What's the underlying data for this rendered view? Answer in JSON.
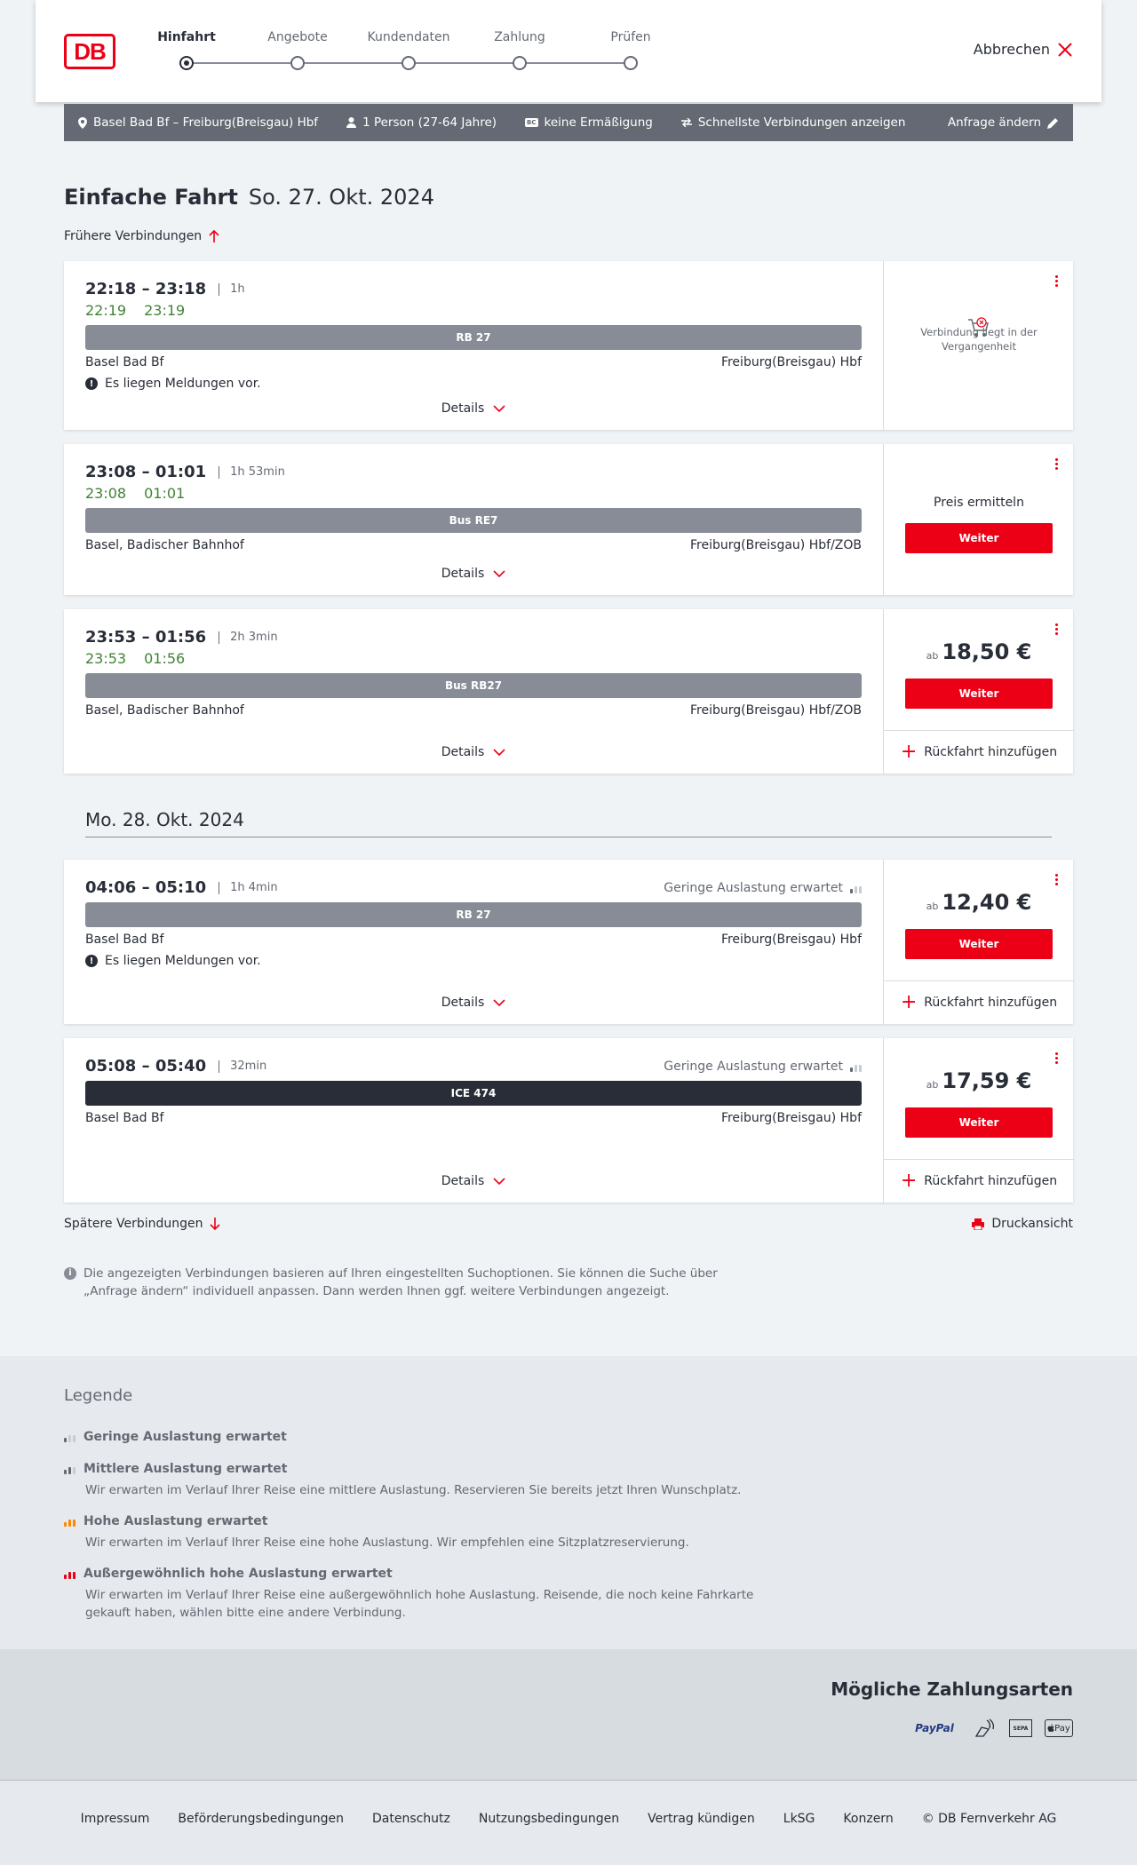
{
  "steps": [
    "Hinfahrt",
    "Angebote",
    "Kundendaten",
    "Zahlung",
    "Prüfen"
  ],
  "cancel": "Abbrechen",
  "search": {
    "route": "Basel Bad Bf – Freiburg(Breisgau) Hbf",
    "persons": "1 Person (27-64 Jahre)",
    "bc_badge": "BC",
    "discount": "keine Ermäßigung",
    "fastest": "Schnellste Verbindungen anzeigen",
    "change": "Anfrage ändern"
  },
  "heading": {
    "main": "Einfache Fahrt",
    "date": "So. 27. Okt. 2024"
  },
  "earlier": "Frühere Verbindungen",
  "later": "Spätere Verbindungen",
  "print": "Druckansicht",
  "details_label": "Details",
  "return_label": "Rückfahrt hinzufügen",
  "weiter_label": "Weiter",
  "price_prefix": "ab",
  "message": "Es liegen Meldungen vor.",
  "load_label": "Geringe Auslastung erwartet",
  "connections": [
    {
      "time": "22:18 – 23:18",
      "duration": "1h",
      "rt_dep": "22:19",
      "rt_arr": "23:19",
      "train": "RB 27",
      "from": "Basel Bad Bf",
      "to": "Freiburg(Breisgau) Hbf",
      "past": "Verbindung liegt in der Vergangenheit"
    },
    {
      "time": "23:08 – 01:01",
      "duration": "1h 53min",
      "rt_dep": "23:08",
      "rt_arr": "01:01",
      "train": "Bus RE7",
      "from": "Basel, Badischer Bahnhof",
      "to": "Freiburg(Breisgau) Hbf/ZOB",
      "price_text": "Preis ermitteln"
    },
    {
      "time": "23:53 – 01:56",
      "duration": "2h 3min",
      "rt_dep": "23:53",
      "rt_arr": "01:56",
      "train": "Bus RB27",
      "from": "Basel, Badischer Bahnhof",
      "to": "Freiburg(Breisgau) Hbf/ZOB",
      "price": "18,50 €"
    },
    {
      "time": "04:06 – 05:10",
      "duration": "1h 4min",
      "train": "RB 27",
      "from": "Basel Bad Bf",
      "to": "Freiburg(Breisgau) Hbf",
      "price": "12,40 €"
    },
    {
      "time": "05:08 – 05:40",
      "duration": "32min",
      "train": "ICE 474",
      "from": "Basel Bad Bf",
      "to": "Freiburg(Breisgau) Hbf",
      "price": "17,59 €"
    }
  ],
  "date2": "Mo. 28. Okt. 2024",
  "info": "Die angezeigten Verbindungen basieren auf Ihren eingestellten Suchoptionen. Sie können die Suche über „Anfrage ändern“ individuell anpassen. Dann werden Ihnen ggf. weitere Verbindungen angezeigt.",
  "legend": {
    "title": "Legende",
    "items": [
      {
        "title": "Geringe Auslastung erwartet",
        "desc": ""
      },
      {
        "title": "Mittlere Auslastung erwartet",
        "desc": "Wir erwarten im Verlauf Ihrer Reise eine mittlere Auslastung. Reservieren Sie bereits jetzt Ihren Wunschplatz."
      },
      {
        "title": "Hohe Auslastung erwartet",
        "desc": "Wir erwarten im Verlauf Ihrer Reise eine hohe Auslastung. Wir empfehlen eine Sitzplatzreservierung."
      },
      {
        "title": "Außergewöhnlich hohe Auslastung erwartet",
        "desc": "Wir erwarten im Verlauf Ihrer Reise eine außergewöhnlich hohe Auslastung. Reisende, die noch keine Fahrkarte gekauft haben, wählen bitte eine andere Verbindung."
      }
    ]
  },
  "payment": {
    "title": "Mögliche Zahlungsarten",
    "methods": [
      "PayPal",
      "SEPA",
      "Pay"
    ]
  },
  "footer": [
    "Impressum",
    "Beförderungsbedingungen",
    "Datenschutz",
    "Nutzungsbedingungen",
    "Vertrag kündigen",
    "LkSG",
    "Konzern",
    "© DB Fernverkehr AG"
  ],
  "colors": {
    "brand_red": "#ec0016",
    "realtime_green": "#408335",
    "bar_gray": "#878c96",
    "ice_dark": "#282d37"
  }
}
